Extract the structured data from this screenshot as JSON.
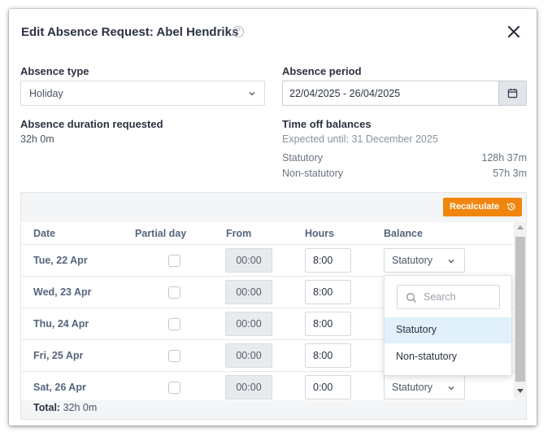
{
  "dialog": {
    "title": "Edit Absence Request: Abel Hendriks",
    "help_icon": "help-circle-icon",
    "close_icon": "close-icon"
  },
  "absence_type": {
    "label": "Absence type",
    "value": "Holiday"
  },
  "absence_period": {
    "label": "Absence period",
    "value": "22/04/2025 - 26/04/2025",
    "icon": "calendar-icon"
  },
  "duration": {
    "label": "Absence duration requested",
    "value": "32h 0m"
  },
  "balances": {
    "label": "Time off balances",
    "expected": "Expected until: 31 December 2025",
    "items": [
      {
        "name": "Statutory",
        "value": "128h 37m"
      },
      {
        "name": "Non-statutory",
        "value": "57h 3m"
      }
    ]
  },
  "grid": {
    "recalculate_label": "Recalculate",
    "recalc_color": "#f0860f",
    "columns": [
      "Date",
      "Partial day",
      "From",
      "Hours",
      "Balance"
    ],
    "rows": [
      {
        "date": "Tue, 22 Apr",
        "from": "00:00",
        "hours": "8:00",
        "balance": "Statutory"
      },
      {
        "date": "Wed, 23 Apr",
        "from": "00:00",
        "hours": "8:00",
        "balance": ""
      },
      {
        "date": "Thu, 24 Apr",
        "from": "00:00",
        "hours": "8:00",
        "balance": ""
      },
      {
        "date": "Fri, 25 Apr",
        "from": "00:00",
        "hours": "8:00",
        "balance": ""
      },
      {
        "date": "Sat, 26 Apr",
        "from": "00:00",
        "hours": "0:00",
        "balance": "Statutory"
      }
    ],
    "total_label": "Total:",
    "total_value": "32h 0m"
  },
  "balance_dropdown": {
    "search_placeholder": "Search",
    "options": [
      "Statutory",
      "Non-statutory"
    ],
    "highlighted": "Statutory",
    "highlight_color": "#e0f1fb"
  }
}
